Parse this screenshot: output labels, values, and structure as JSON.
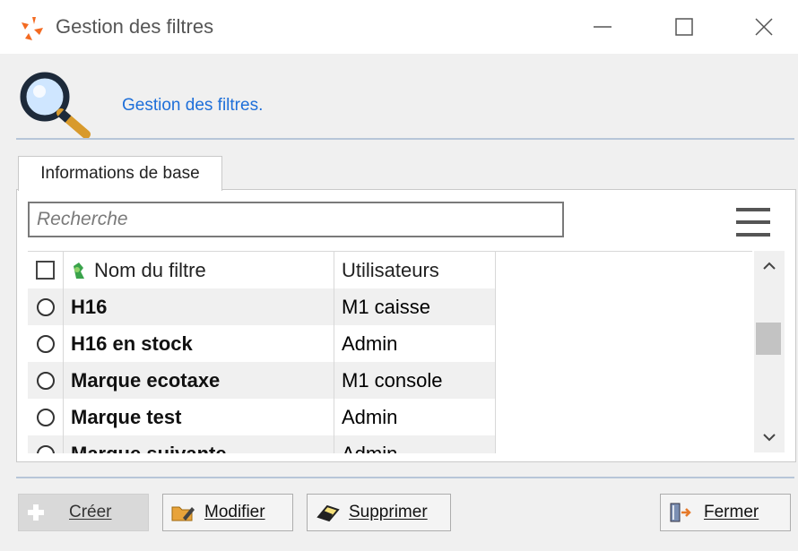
{
  "window": {
    "title": "Gestion des filtres"
  },
  "header": {
    "description": "Gestion des filtres."
  },
  "tabs": [
    {
      "label": "Informations de base"
    }
  ],
  "search": {
    "placeholder": "Recherche",
    "value": ""
  },
  "grid": {
    "columns": [
      "Nom du filtre",
      "Utilisateurs"
    ],
    "rows": [
      {
        "name": "H16",
        "users": "M1 caisse"
      },
      {
        "name": "H16 en stock",
        "users": "Admin"
      },
      {
        "name": "Marque ecotaxe",
        "users": "M1 console"
      },
      {
        "name": "Marque test",
        "users": "Admin"
      },
      {
        "name": "Marque suivante",
        "users": "Admin"
      }
    ]
  },
  "buttons": {
    "create": "Créer",
    "edit": "Modifier",
    "delete": "Supprimer",
    "close": "Fermer"
  },
  "colors": {
    "accent_text": "#1e6fd9",
    "separator": "#b7c6d8"
  },
  "icons": [
    "app-logo-icon",
    "magnifier-icon",
    "minimize-icon",
    "maximize-icon",
    "close-icon",
    "hamburger-menu-icon",
    "filter-icon",
    "plus-icon",
    "folder-edit-icon",
    "eraser-icon",
    "exit-door-icon",
    "chevron-up-icon",
    "chevron-down-icon"
  ]
}
